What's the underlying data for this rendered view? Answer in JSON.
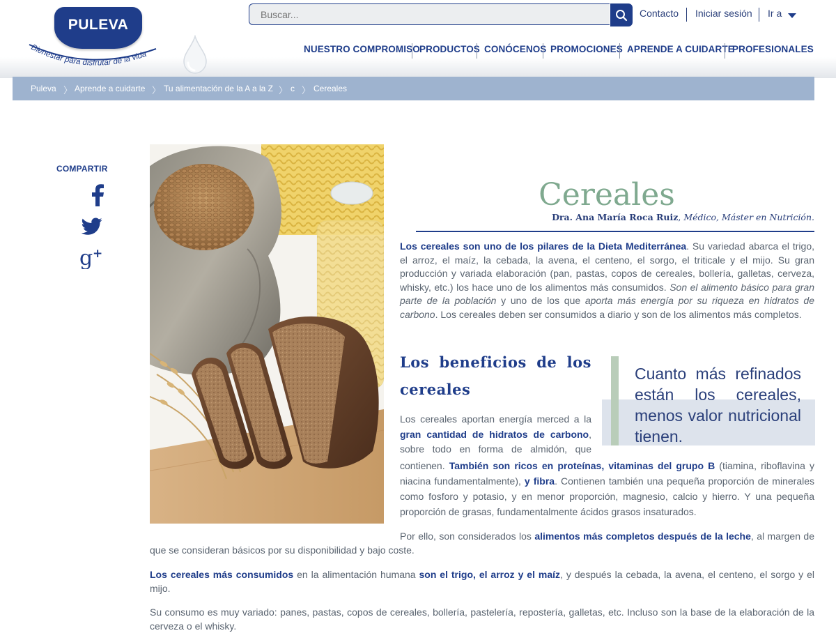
{
  "header": {
    "logo_text": "PULEVA",
    "logo_tagline": "Bienestar para disfrutar de la vida",
    "search_placeholder": "Buscar...",
    "top_links": [
      "Contacto",
      "Iniciar sesión",
      "Ir a"
    ],
    "nav": [
      "NUESTRO COMPROMISO",
      "PRODUCTOS",
      "CONÓCENOS",
      "PROMOCIONES",
      "APRENDE A CUIDARTE",
      "PROFESIONALES"
    ]
  },
  "breadcrumb": [
    "Puleva",
    "Aprende a cuidarte",
    "Tu alimentación de la A a la Z",
    "c",
    "Cereales"
  ],
  "share": {
    "label": "COMPARTIR",
    "networks": [
      "facebook-icon",
      "twitter-icon",
      "google-plus-icon"
    ]
  },
  "article": {
    "title": "Cereales",
    "author_name": "Dra. Ana María Roca Ruiz",
    "author_credentials": "Médico, Máster en Nutrición.",
    "intro": [
      {
        "t": "Los cereales son uno de los pilares de la Dieta Mediterránea",
        "s": "b"
      },
      {
        "t": ". Su variedad abarca el trigo, el arroz, el maíz, la cebada, la avena, el centeno, el sorgo, el triticale y el mijo. Su gran producción y variada elaboración (pan, pastas, copos de cereales, bollería, galletas, cerveza, whisky, etc.) los hace uno de los alimentos más consumidos. "
      },
      {
        "t": "Son el alimento básico para gran parte de la población",
        "s": "i"
      },
      {
        "t": " y uno de los que "
      },
      {
        "t": "aporta más energía por su riqueza en hidratos de carbono",
        "s": "i"
      },
      {
        "t": ". Los cereales deben ser consumidos a diario y son de los alimentos más completos."
      }
    ],
    "section_title": "Los beneficios de los cereales",
    "quote": "Cuanto más refinados están los cereales, menos valor nutricional tienen.",
    "benefits_a": [
      {
        "t": "Los cereales aportan energía merced a la "
      },
      {
        "t": "gran cantidad de hidratos de carbono",
        "s": "b"
      },
      {
        "t": ", sobre todo en forma de almidón, que"
      }
    ],
    "benefits_b": [
      {
        "t": "contienen. "
      },
      {
        "t": "También son ricos en proteínas, vitaminas del grupo B",
        "s": "b"
      },
      {
        "t": " (tiamina, riboflavina y niacina fundamentalmente), "
      },
      {
        "t": "y fibra",
        "s": "b"
      },
      {
        "t": ". Contienen también una pequeña proporción de minerales como fosforo y  potasio, y en menor proporción, magnesio, calcio y hierro. Y una pequeña proporción de grasas, fundamentalmente ácidos grasos insaturados."
      }
    ],
    "p_milk": [
      {
        "t": "Por ello, son considerados los "
      },
      {
        "t": "alimentos más completos después de la leche",
        "s": "b"
      },
      {
        "t": ", al margen de que se consideran básicos por su disponibilidad y bajo coste."
      }
    ],
    "p_consumed": [
      {
        "t": "Los cereales más consumidos",
        "s": "b"
      },
      {
        "t": " en la alimentación humana "
      },
      {
        "t": "son el trigo, el arroz y el maíz",
        "s": "b"
      },
      {
        "t": ", y después la cebada, la avena, el centeno, el sorgo y el mijo."
      }
    ],
    "p_uses": [
      {
        "t": "Su consumo es muy variado: panes, pastas, copos de cereales, bollería, pastelería, repostería, galletas, etc. Incluso son la base de la elaboración de la cerveza o el whisky."
      }
    ]
  },
  "colors": {
    "brand": "#1f3d8a",
    "title": "#7fa98f",
    "breadcrumb_bg": "#9eb3cf",
    "quote_bar": "#b9cdb9",
    "quote_bg": "#dde3ec",
    "body_text": "#5a6470"
  }
}
